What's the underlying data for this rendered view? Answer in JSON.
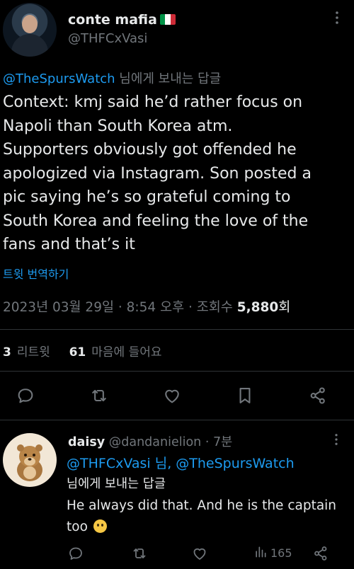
{
  "main_tweet": {
    "author_name": "conte mafia",
    "flag": "italy-flag",
    "handle": "@THFCxVasi",
    "replying_to_handle": "@TheSpursWatch",
    "replying_to_suffix": " 님에게 보내는 답글",
    "text": "Context: kmj said he’d rather focus on\nNapoli than South Korea atm.\nSupporters obviously got offended he\napologized via Instagram. Son posted a\npic saying he’s so grateful coming to\nSouth Korea and feeling the love of the\nfans and that’s it",
    "translate_label": "트윗 번역하기",
    "date": "2023년 03월 29일",
    "time": "8:54 오후",
    "views_label_prefix": "조회수",
    "views": "5,880",
    "views_suffix": "회",
    "retweets": "3",
    "retweets_label": "리트윗",
    "likes": "61",
    "likes_label": "마음에 들어요",
    "actions": [
      "reply-icon",
      "retweet-icon",
      "like-icon",
      "bookmark-icon",
      "share-icon"
    ]
  },
  "reply": {
    "author_name": "daisy",
    "handle": "@dandanielion",
    "time": "7분",
    "mentions": "@THFCxVasi 님, @TheSpursWatch",
    "replying_suffix": "님에게 보내는 답글",
    "text": "He always did that. And he is the captain too",
    "emoji": "slightly-smiling-face",
    "views": "165",
    "actions": [
      "reply-icon",
      "retweet-icon",
      "like-icon",
      "views-icon",
      "share-icon"
    ]
  },
  "colors": {
    "background": "#000000",
    "text": "#e7e9ea",
    "muted": "#71767b",
    "accent": "#1d9bf0",
    "divider": "#2f3336"
  }
}
